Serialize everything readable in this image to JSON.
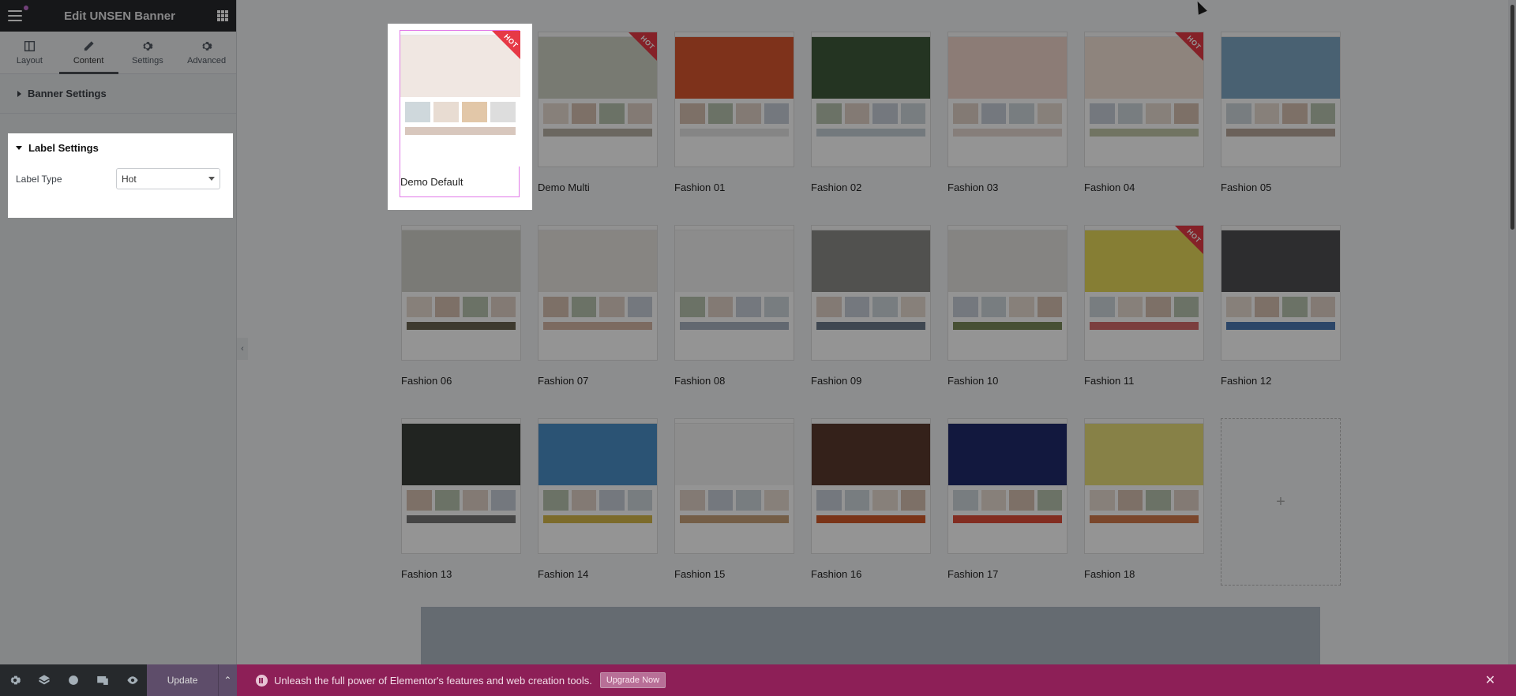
{
  "panel": {
    "title": "Edit UNSEN Banner",
    "tabs": [
      {
        "label": "Layout",
        "icon": "layout-icon"
      },
      {
        "label": "Content",
        "icon": "pencil-icon"
      },
      {
        "label": "Settings",
        "icon": "gear-icon"
      },
      {
        "label": "Advanced",
        "icon": "gear-icon"
      }
    ],
    "sections": {
      "banner_settings": "Banner Settings",
      "label_settings": "Label Settings"
    },
    "label_type": {
      "label": "Label Type",
      "value": "Hot"
    },
    "update_label": "Update"
  },
  "demos": [
    {
      "label": "Demo Default",
      "hot": true,
      "hero": "#f0e7e2",
      "band": "#d8c7bd"
    },
    {
      "label": "Demo Multi",
      "hot": true,
      "hero": "#cfd2c5",
      "band": "#b8b1a6"
    },
    {
      "label": "Fashion 01",
      "hot": false,
      "hero": "#d9572f",
      "band": "#e6e6e6"
    },
    {
      "label": "Fashion 02",
      "hot": false,
      "hero": "#3f5a3c",
      "band": "#c7d0d8"
    },
    {
      "label": "Fashion 03",
      "hot": false,
      "hero": "#f1d6cc",
      "band": "#e7d9d2"
    },
    {
      "label": "Fashion 04",
      "hot": true,
      "hero": "#f4e4d7",
      "band": "#c3c8a9"
    },
    {
      "label": "Fashion 05",
      "hot": false,
      "hero": "#7fa7c4",
      "band": "#b9a89b"
    },
    {
      "label": "Fashion 06",
      "hot": false,
      "hero": "#d3d2cc",
      "band": "#6b6551"
    },
    {
      "label": "Fashion 07",
      "hot": false,
      "hero": "#e9e6e1",
      "band": "#d6b7a6"
    },
    {
      "label": "Fashion 08",
      "hot": false,
      "hero": "#f2f2f2",
      "band": "#a9b3c2"
    },
    {
      "label": "Fashion 09",
      "hot": false,
      "hero": "#8c8c88",
      "band": "#6d7a8c"
    },
    {
      "label": "Fashion 10",
      "hot": false,
      "hero": "#e5e4e1",
      "band": "#7a8b5a"
    },
    {
      "label": "Fashion 11",
      "hot": true,
      "hero": "#e7d95a",
      "band": "#d46b6b"
    },
    {
      "label": "Fashion 12",
      "hot": false,
      "hero": "#4f4f52",
      "band": "#4c79b3"
    },
    {
      "label": "Fashion 13",
      "hot": false,
      "hero": "#3a3f3a",
      "band": "#777777"
    },
    {
      "label": "Fashion 14",
      "hot": false,
      "hero": "#4b8fc9",
      "band": "#d6b84a"
    },
    {
      "label": "Fashion 15",
      "hot": false,
      "hero": "#f3f3f3",
      "band": "#c9a27b"
    },
    {
      "label": "Fashion 16",
      "hot": false,
      "hero": "#5a3a2d",
      "band": "#d25b2a"
    },
    {
      "label": "Fashion 17",
      "hot": false,
      "hero": "#1f2a6b",
      "band": "#e04f3a"
    },
    {
      "label": "Fashion 18",
      "hot": false,
      "hero": "#e8de7a",
      "band": "#d37b4c"
    }
  ],
  "hot_badge": "HOT",
  "add_placeholder": "+",
  "promo": {
    "text": "Unleash the full power of Elementor's features and web creation tools.",
    "button": "Upgrade Now"
  },
  "colors": {
    "accent": "#8d1f57",
    "hot": "#e63946",
    "panel_dark": "#26292c"
  }
}
